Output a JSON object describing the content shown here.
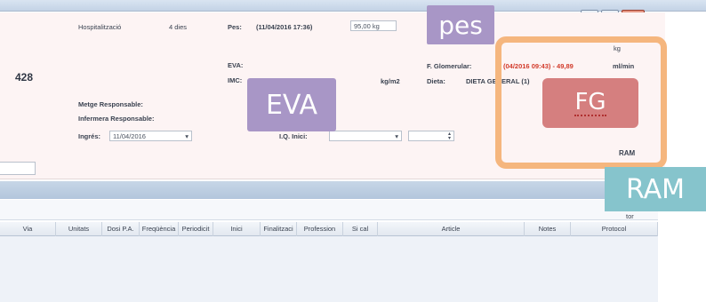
{
  "patient": {
    "number": "428"
  },
  "admission": {
    "hospitalitzacio_label": "Hospitalització",
    "hospitalitzacio_value": "4 dies",
    "metge_label": "Metge Responsable:",
    "infermera_label": "Infermera Responsable:",
    "ingres_label": "Ingrés:",
    "ingres_value": "11/04/2016",
    "iq_label": "I.Q. Inici:",
    "iq_value": ""
  },
  "vitals": {
    "pes_label": "Pes:",
    "pes_date": "(11/04/2016 17:36)",
    "pes_value": "95,00",
    "pes_unit": "kg",
    "eva_label": "EVA:",
    "imc_label": "IMC:",
    "imc_unit": "kg/m2",
    "dieta_label": "Dieta:",
    "dieta_value": "DIETA GENERAL (1)",
    "fg_label": "F. Glomerular:",
    "fg_value": "(04/2016 09:43) - 49,89",
    "fg_unit": "ml/min",
    "top_unit": "kg",
    "ram_label": "RAM"
  },
  "grid": {
    "tail_label": "tor",
    "columns": [
      "Via",
      "Unitats",
      "Dosi P.A.",
      "Freqüència",
      "Periodicit",
      "Inici",
      "Finalitzaci",
      "Profession",
      "Si cal",
      "Article",
      "Notes",
      "Protocol"
    ]
  },
  "search": {
    "placeholder": ""
  },
  "annotations": {
    "pes": "pes",
    "eva": "EVA",
    "fg": "FG",
    "ram": "RAM"
  },
  "colors": {
    "annotation_purple": "#a896c6",
    "annotation_red": "#d57f7f",
    "annotation_teal": "#86c4cc",
    "highlight_orange": "#f5b67e",
    "fg_value_red": "#d23b2b"
  }
}
